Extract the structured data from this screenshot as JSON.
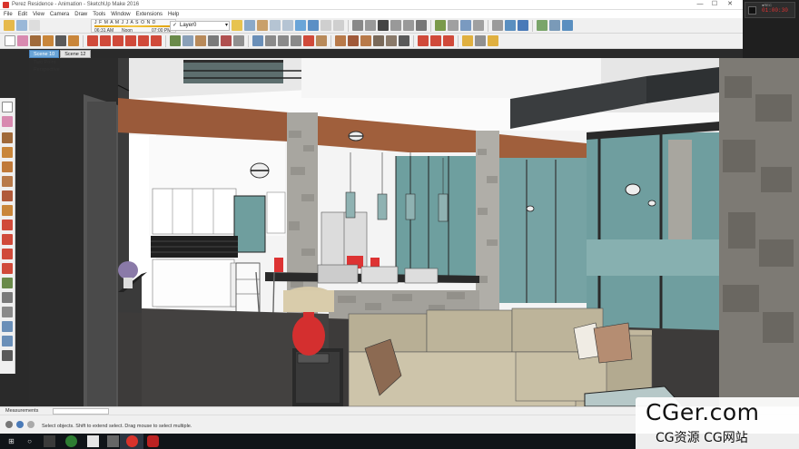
{
  "window": {
    "title": "Perez Residence - Animation - SketchUp Make 2016",
    "minimize_glyph": "—",
    "maximize_glyph": "☐",
    "close_glyph": "✕"
  },
  "menu": [
    "File",
    "Edit",
    "View",
    "Camera",
    "Draw",
    "Tools",
    "Window",
    "Extensions",
    "Help"
  ],
  "shadow_settings": {
    "months": "J F M A M J J A S O N D",
    "time_start": "06:31 AM",
    "time_mid": "Noon",
    "time_end": "07:00 PM"
  },
  "layer": {
    "current": "Layer0",
    "check": "✓",
    "arrow": "▾"
  },
  "recorder": {
    "label": "●REC",
    "time": "01:00:30"
  },
  "scenes": {
    "tabs": [
      "Scene 10",
      "Scene 12"
    ],
    "active_index": 0
  },
  "viewport": {
    "style_label": "Two Point",
    "camera_label": "Perspective"
  },
  "measurements": {
    "label": "Measurements",
    "value": ""
  },
  "status": {
    "message": "Select objects. Shift to extend select. Drag mouse to select multiple."
  },
  "taskbar": {
    "start_glyph": "⊞",
    "search_glyph": "○"
  },
  "watermark": {
    "main": "CGer.com",
    "sub": "CG资源 CG网站"
  },
  "colors": {
    "accent": "#6aa5d8",
    "record": "#d33333",
    "sketchup_red": "#d8332b"
  }
}
